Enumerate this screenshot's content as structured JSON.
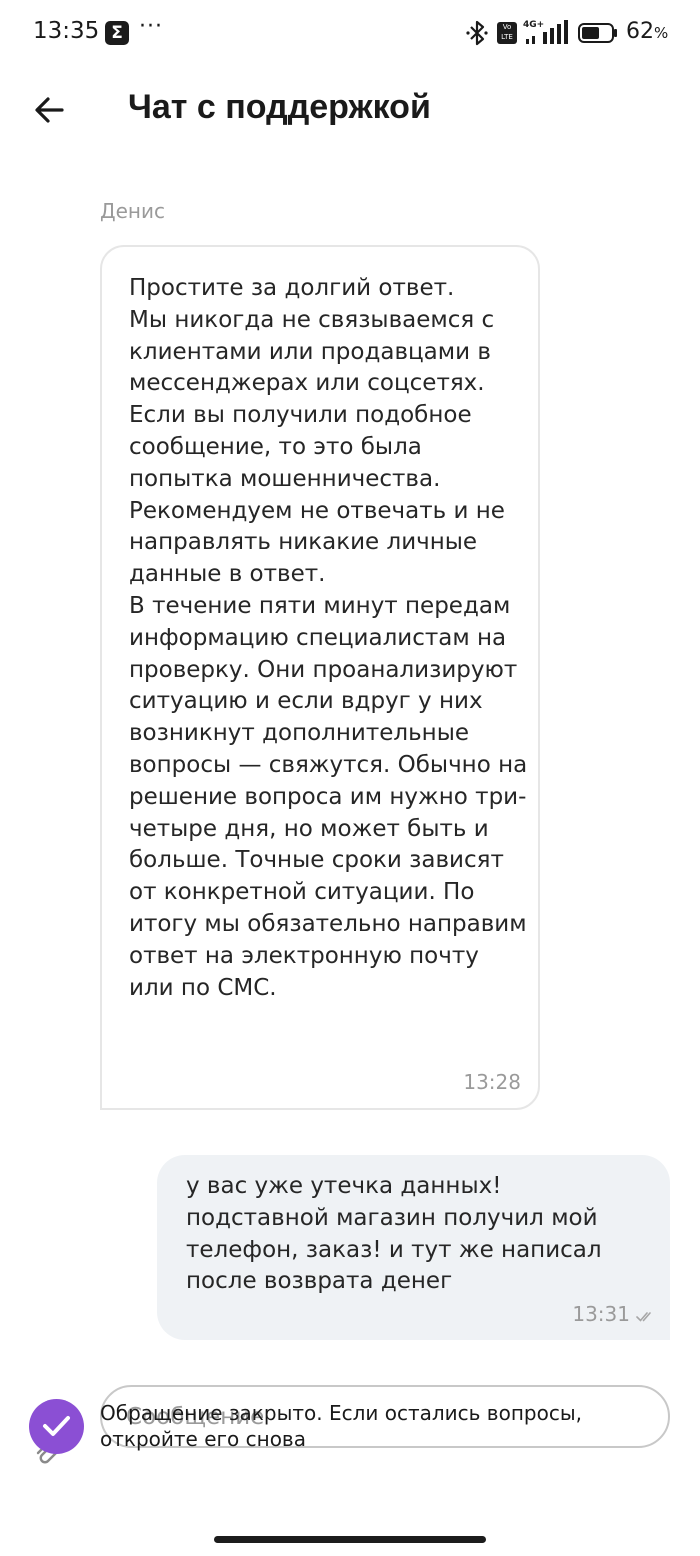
{
  "status_bar": {
    "time": "13:35",
    "app_icon_glyph": "Σ",
    "more_glyph": "···",
    "volte_label": "Vo LTE",
    "network_label": "4G+",
    "battery_percent": "62",
    "battery_unit": "%",
    "battery_level": 0.62
  },
  "header": {
    "title": "Чат с поддержкой",
    "back_icon": "arrow-left-icon"
  },
  "messages": [
    {
      "direction": "incoming",
      "sender": "Денис",
      "text": "Простите за долгий ответ.\nМы никогда не связываемся с клиентами или продавцами в мессенджерах или соцсетях. Если вы получили подобное сообщение, то это была попытка мошенничества. Рекомендуем не отвечать и не направлять никакие личные данные в ответ.\nВ течение пяти минут передам информацию специалистам на проверку. Они проанализируют ситуацию и если вдруг у них возникнут дополнительные вопросы — свяжутся. Обычно на решение вопроса им нужно три-четыре дня, но может быть и больше. Точные сроки зависят от конкретной ситуации. По итогу мы обязательно направим ответ на электронную почту или по СМС.",
      "time": "13:28"
    },
    {
      "direction": "outgoing",
      "text": "у вас уже утечка данных!\nподставной магазин получил мой телефон, заказ! и тут же написал после возврата денег",
      "time": "13:31",
      "status_icon": "double-check-icon"
    }
  ],
  "composer": {
    "placeholder": "Сообщение"
  },
  "toast": {
    "text": "Обращение закрыто. Если остались вопросы,\nоткройте его снова",
    "icon": "check-circle-icon",
    "accent_color": "#8b4fd4"
  }
}
